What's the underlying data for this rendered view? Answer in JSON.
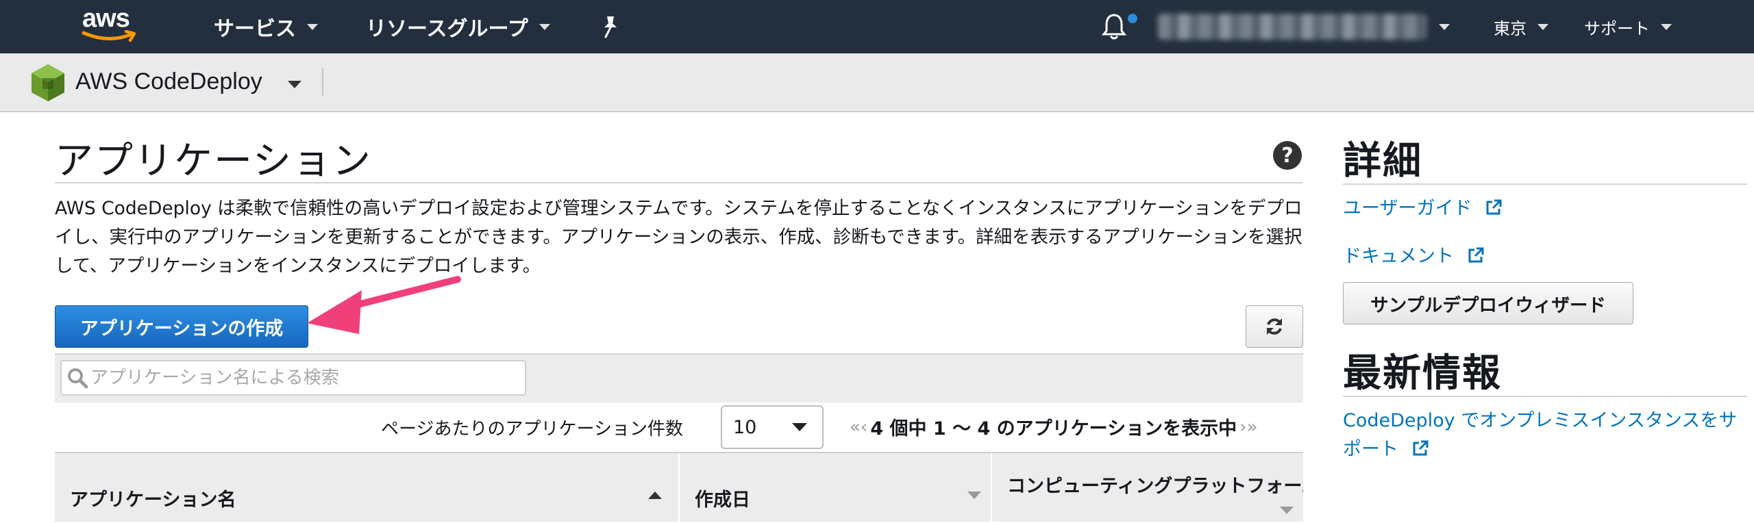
{
  "topnav": {
    "logo_text": "aws",
    "services": "サービス",
    "resource_groups": "リソースグループ",
    "region": "東京",
    "support": "サポート"
  },
  "service_bar": {
    "name": "AWS CodeDeploy"
  },
  "main": {
    "title": "アプリケーション",
    "help": "?",
    "description": "AWS CodeDeploy は柔軟で信頼性の高いデプロイ設定および管理システムです。システムを停止することなくインスタンスにアプリケーションをデプロイし、実行中のアプリケーションを更新することができます。アプリケーションの表示、作成、診断もできます。詳細を表示するアプリケーションを選択して、アプリケーションをインスタンスにデプロイします。",
    "create_button": "アプリケーションの作成",
    "search_placeholder": "アプリケーション名による検索",
    "per_page_label": "ページあたりのアプリケーション件数",
    "per_page_value": "10",
    "pager_text": "4 個中 1 〜 4 のアプリケーションを表示中",
    "pager_first": "«",
    "pager_prev": "‹",
    "pager_next": "›",
    "pager_last": "»",
    "columns": [
      "アプリケーション名",
      "作成日",
      "コンピューティングプラットフォーム"
    ]
  },
  "sidebar": {
    "details_title": "詳細",
    "user_guide": "ユーザーガイド",
    "documents": "ドキュメント",
    "sample_wizard": "サンプルデプロイウィザード",
    "news_title": "最新情報",
    "news_link": "CodeDeploy でオンプレミスインスタンスをサポート"
  },
  "colors": {
    "nav_bg": "#232f3e",
    "primary_button": "#1767bf",
    "link": "#0073bb",
    "notification_dot": "#2a8cdc",
    "callout_arrow": "#f0407a"
  }
}
